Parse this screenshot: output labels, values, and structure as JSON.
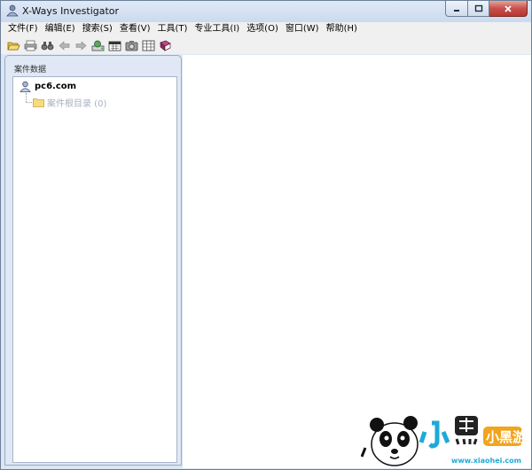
{
  "window": {
    "title": "X-Ways Investigator"
  },
  "menu": [
    {
      "label": "文件(F)"
    },
    {
      "label": "编辑(E)"
    },
    {
      "label": "搜索(S)"
    },
    {
      "label": "查看(V)"
    },
    {
      "label": "工具(T)"
    },
    {
      "label": "专业工具(I)"
    },
    {
      "label": "选项(O)"
    },
    {
      "label": "窗口(W)"
    },
    {
      "label": "帮助(H)"
    }
  ],
  "toolbar": [
    {
      "icon": "open-folder-icon"
    },
    {
      "icon": "print-icon"
    },
    {
      "icon": "binoculars-icon"
    },
    {
      "icon": "back-arrow-icon"
    },
    {
      "icon": "forward-arrow-icon"
    },
    {
      "icon": "disk-icon"
    },
    {
      "icon": "calendar-icon"
    },
    {
      "icon": "camera-icon"
    },
    {
      "icon": "grid-icon"
    },
    {
      "icon": "book-icon"
    }
  ],
  "case_panel": {
    "title": "案件数据",
    "root": {
      "label": "pc6.com",
      "icon": "case-user-icon"
    },
    "children": [
      {
        "label": "案件根目录 (0)",
        "icon": "folder-icon"
      }
    ]
  },
  "watermark": {
    "brand": "小黑游戏",
    "domain": "www.xiaohei.com"
  },
  "colors": {
    "window_frame": "#dce6f3",
    "close_button": "#c75050",
    "tree_child_text": "#a7b1c1"
  }
}
